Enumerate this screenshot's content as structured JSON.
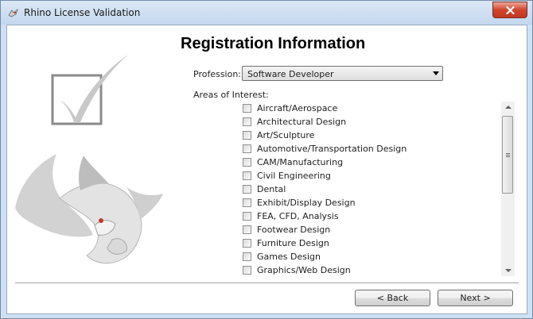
{
  "window": {
    "title": "Rhino License Validation"
  },
  "page": {
    "heading": "Registration Information"
  },
  "profession": {
    "label": "Profession:",
    "selected": "Software Developer"
  },
  "areas": {
    "label": "Areas of Interest:",
    "items": [
      "Aircraft/Aerospace",
      "Architectural Design",
      "Art/Sculpture",
      "Automotive/Transportation Design",
      "CAM/Manufacturing",
      "Civil Engineering",
      "Dental",
      "Exhibit/Display Design",
      "FEA, CFD, Analysis",
      "Footwear Design",
      "Furniture Design",
      "Games Design",
      "Graphics/Web Design"
    ]
  },
  "buttons": {
    "back": "< Back",
    "next": "Next >"
  },
  "icons": {
    "app": "rhino-icon",
    "close": "close-icon",
    "checkmark": "checkmark-logo",
    "rhino": "rhino-logo"
  }
}
